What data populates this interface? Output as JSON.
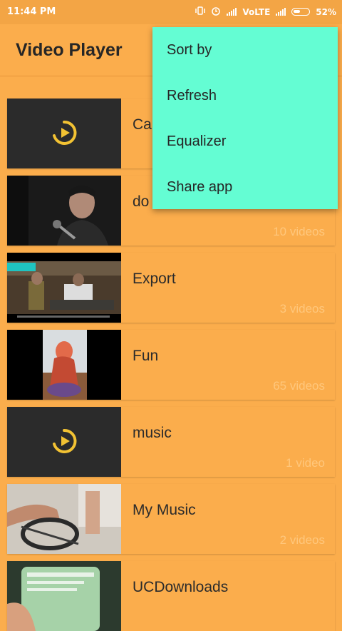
{
  "status_bar": {
    "time": "11:44 PM",
    "network": "VoLTE",
    "battery": "52%"
  },
  "app_bar": {
    "title": "Video Player"
  },
  "folders": [
    {
      "name": "Ca",
      "count": "",
      "thumb": "play-placeholder"
    },
    {
      "name": "do",
      "count": "10 videos",
      "thumb": "singer"
    },
    {
      "name": "Export",
      "count": "3 videos",
      "thumb": "room-scene"
    },
    {
      "name": "Fun",
      "count": "65 videos",
      "thumb": "doll"
    },
    {
      "name": "music",
      "count": "1 video",
      "thumb": "play-placeholder"
    },
    {
      "name": "My Music",
      "count": "2 videos",
      "thumb": "hands"
    },
    {
      "name": "UCDownloads",
      "count": "",
      "thumb": "phone"
    }
  ],
  "menu": {
    "items": [
      {
        "label": "Sort by"
      },
      {
        "label": "Refresh"
      },
      {
        "label": "Equalizer"
      },
      {
        "label": "Share app"
      }
    ]
  },
  "colors": {
    "background": "#fbad4c",
    "menu": "#64fdd3",
    "play_icon": "#f2c233",
    "count_text": "#ffc77c"
  }
}
